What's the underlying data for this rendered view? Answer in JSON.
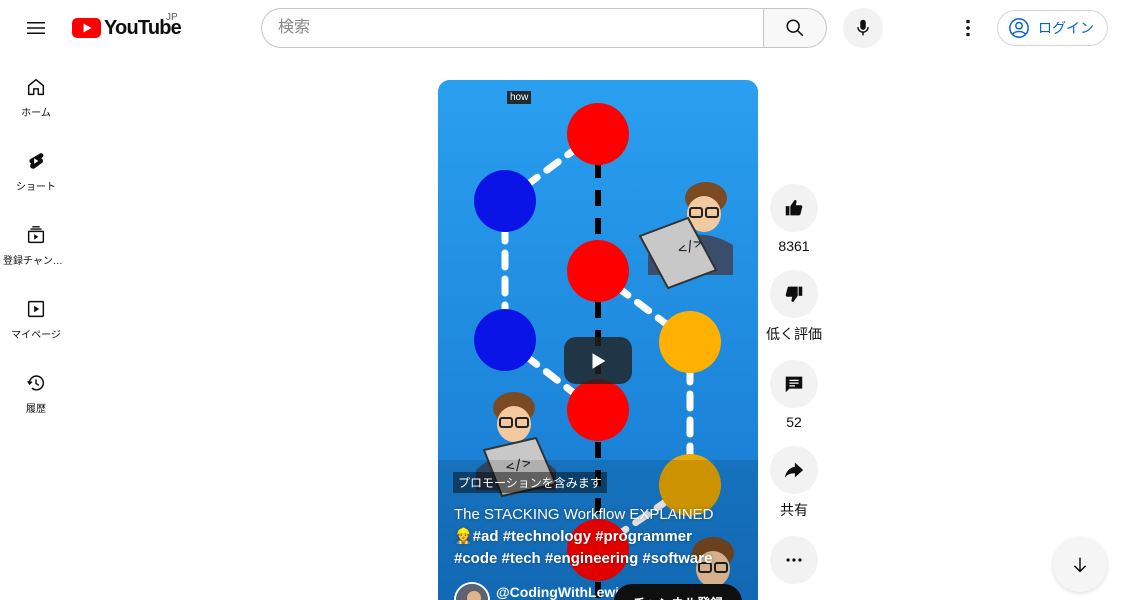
{
  "header": {
    "logo_text": "YouTube",
    "region": "JP",
    "search_placeholder": "検索",
    "login_label": "ログイン"
  },
  "nav": {
    "items": [
      {
        "label": "ホーム",
        "icon": "home-icon"
      },
      {
        "label": "ショート",
        "icon": "shorts-icon"
      },
      {
        "label": "登録チャンネル",
        "icon": "subscriptions-icon"
      },
      {
        "label": "マイページ",
        "icon": "you-icon"
      },
      {
        "label": "履歴",
        "icon": "history-icon"
      }
    ]
  },
  "video": {
    "overlay_tag": "how",
    "promo_label": "プロモーションを含みます",
    "title_line": "The STACKING Workflow EXPLAINED",
    "hashtags_line1": "👷#ad #technology #programmer",
    "hashtags_line2": "#code #tech #engineering #software",
    "channel_name": "@CodingWithLewi",
    "subscribe_label": "チャンネル登録"
  },
  "actions": {
    "like_count": "8361",
    "dislike_label": "低く評価",
    "comment_count": "52",
    "share_label": "共有"
  },
  "colors": {
    "brand_red": "#ff0000",
    "link_blue": "#065fd4",
    "video_bg": "#1c8be0",
    "node_red": "#ff0000",
    "node_blue": "#0a14e6",
    "node_yellow": "#ffb000"
  }
}
